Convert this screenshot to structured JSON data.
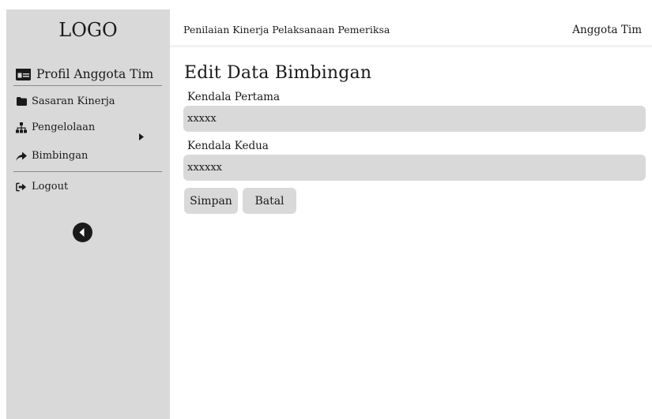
{
  "sidebar": {
    "logo": "LOGO",
    "profile_label": "Profil Anggota Tim",
    "items": [
      {
        "label": "Sasaran Kinerja",
        "icon": "folder-icon"
      },
      {
        "label": "Pengelolaan",
        "icon": "sitemap-icon",
        "has_submenu": true
      },
      {
        "label": "Bimbingan",
        "icon": "share-arrow-icon"
      },
      {
        "label": "Logout",
        "icon": "sign-out-icon"
      }
    ],
    "collapse_icon": "chevron-circle-left-icon"
  },
  "header": {
    "app_title": "Penilaian Kinerja Pelaksanaan Pemeriksa",
    "user_role": "Anggota Tim"
  },
  "main": {
    "title": "Edit Data Bimbingan",
    "fields": [
      {
        "label": "Kendala Pertama",
        "value": "xxxxx"
      },
      {
        "label": "Kendala Kedua",
        "value": "xxxxxx"
      }
    ],
    "save_label": "Simpan",
    "cancel_label": "Batal"
  },
  "colors": {
    "sidebar_bg": "#d9d9d9",
    "input_bg": "#d9d9d9",
    "text": "#1a1a1a"
  }
}
